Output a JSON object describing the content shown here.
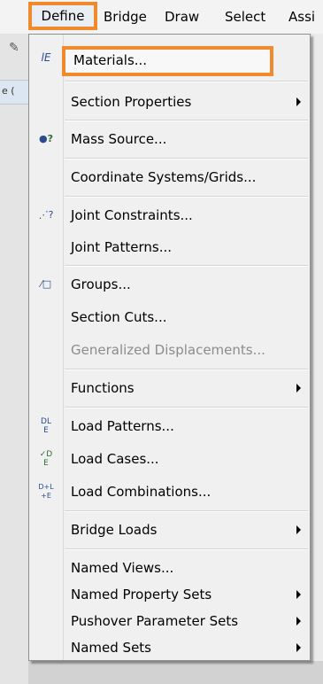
{
  "menubar": {
    "items": [
      {
        "label": "Define"
      },
      {
        "label": "Bridge"
      },
      {
        "label": "Draw"
      },
      {
        "label": "Select"
      },
      {
        "label": "Assi"
      }
    ]
  },
  "left_strip": {
    "text": "e ("
  },
  "menu": {
    "items": [
      {
        "label": "Materials...",
        "icon": "materials-icon",
        "highlighted": true
      },
      {
        "label": "Section Properties",
        "submenu": true
      },
      {
        "label": "Mass Source...",
        "icon": "mass-source-icon"
      },
      {
        "label": "Coordinate Systems/Grids..."
      },
      {
        "label": "Joint Constraints...",
        "icon": "joint-constraints-icon"
      },
      {
        "label": "Joint Patterns..."
      },
      {
        "label": "Groups...",
        "icon": "groups-icon"
      },
      {
        "label": "Section Cuts..."
      },
      {
        "label": "Generalized Displacements...",
        "disabled": true
      },
      {
        "label": "Functions",
        "submenu": true
      },
      {
        "label": "Load Patterns...",
        "icon": "load-patterns-icon"
      },
      {
        "label": "Load Cases...",
        "icon": "load-cases-icon"
      },
      {
        "label": "Load Combinations...",
        "icon": "load-combinations-icon"
      },
      {
        "label": "Bridge Loads",
        "submenu": true
      },
      {
        "label": "Named Views..."
      },
      {
        "label": "Named Property Sets",
        "submenu": true
      },
      {
        "label": "Pushover Parameter Sets",
        "submenu": true
      },
      {
        "label": "Named Sets",
        "submenu": true
      }
    ],
    "icons": {
      "materials": "ⅼE",
      "mass_dot": "●",
      "mass_q": "?",
      "joint": "⋰?",
      "groups": "⁄□",
      "load_patterns_top": "DL",
      "load_patterns_bot": "E",
      "load_cases_top": "✓D",
      "load_cases_bot": "E",
      "load_combos_top": "D+L",
      "load_combos_bot": "+E"
    }
  },
  "colors": {
    "highlight_border": "#f08a2c",
    "disabled_text": "#8c8c8c",
    "menu_bg": "#f0f0f0"
  }
}
